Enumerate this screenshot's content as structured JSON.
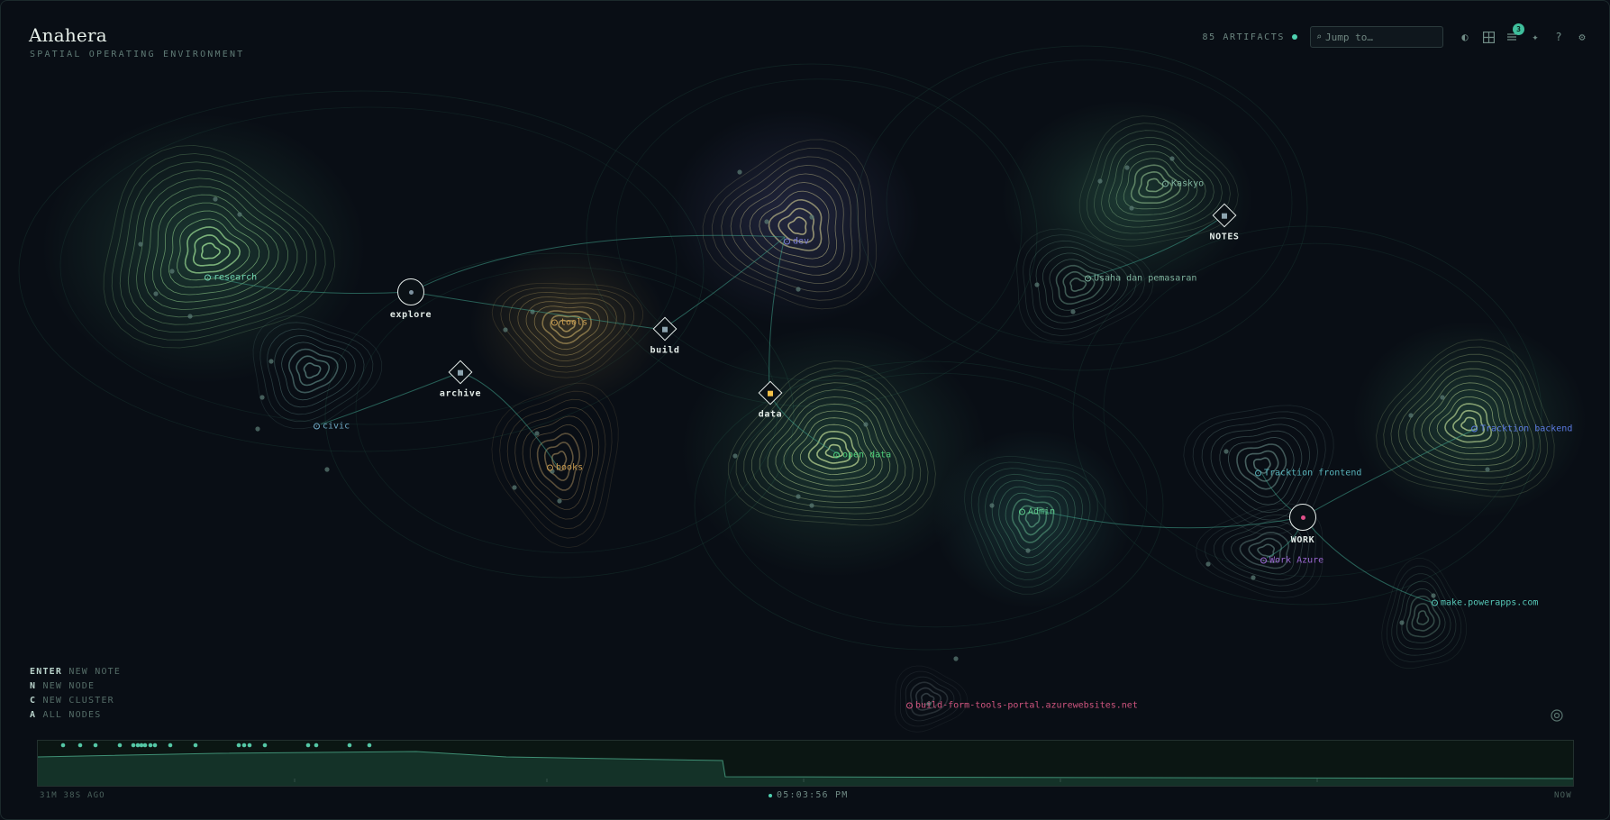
{
  "app": {
    "title": "Anahera",
    "subtitle": "SPATIAL OPERATING ENVIRONMENT"
  },
  "topbar": {
    "artifacts_label": "85 ARTIFACTS",
    "search_placeholder": "Jump to…",
    "notifications_badge": "3",
    "icons": [
      "theme-toggle-icon",
      "grid-layout-icon",
      "inbox-icon",
      "sparkle-icon",
      "help-icon",
      "settings-icon"
    ]
  },
  "clusters": [
    {
      "id": "research",
      "label": "research",
      "color": "#6fd3b0"
    },
    {
      "id": "civic",
      "label": "civic",
      "color": "#6fa9c4"
    },
    {
      "id": "tools",
      "label": "tools",
      "color": "#c79a4f"
    },
    {
      "id": "books",
      "label": "books",
      "color": "#c79a4f"
    },
    {
      "id": "dev",
      "label": "dev",
      "color": "#7d7fd6"
    },
    {
      "id": "open-data",
      "label": "open data",
      "color": "#4fd17c"
    },
    {
      "id": "kaskyo",
      "label": "Kaskyo",
      "color": "#7fb39e"
    },
    {
      "id": "usaha",
      "label": "Usaha dan pemasaran",
      "color": "#7fb39e"
    },
    {
      "id": "admin",
      "label": "Admin",
      "color": "#5fcf8f"
    },
    {
      "id": "tracktion-frontend",
      "label": "Tracktion frontend",
      "color": "#57b2b9"
    },
    {
      "id": "tracktion-backend",
      "label": "Tracktion backend",
      "color": "#5a79e0"
    },
    {
      "id": "work-azure",
      "label": "Work Azure",
      "color": "#9a67d0"
    },
    {
      "id": "powerapps",
      "label": "make.powerapps.com",
      "color": "#56c6b6"
    },
    {
      "id": "portal",
      "label": "build-form-tools-portal.azurewebsites.net",
      "color": "#d0557f"
    }
  ],
  "hubs": [
    {
      "id": "explore",
      "label": "explore",
      "shape": "circle"
    },
    {
      "id": "archive",
      "label": "archive",
      "shape": "diamond"
    },
    {
      "id": "build",
      "label": "build",
      "shape": "diamond"
    },
    {
      "id": "data",
      "label": "data",
      "shape": "diamond",
      "accent": "#f5c24a"
    },
    {
      "id": "notes",
      "label": "NOTES",
      "shape": "diamond"
    },
    {
      "id": "work",
      "label": "WORK",
      "shape": "circle",
      "accent": "#e0508a"
    }
  ],
  "shortcuts": [
    {
      "key": "ENTER",
      "label": "NEW NOTE"
    },
    {
      "key": "N",
      "label": "NEW NODE"
    },
    {
      "key": "C",
      "label": "NEW CLUSTER"
    },
    {
      "key": "A",
      "label": "ALL NODES"
    }
  ],
  "timeline": {
    "start_label": "31M 38S AGO",
    "current_time": "05:03:56 PM",
    "end_label": "NOW",
    "event_count": 20
  }
}
